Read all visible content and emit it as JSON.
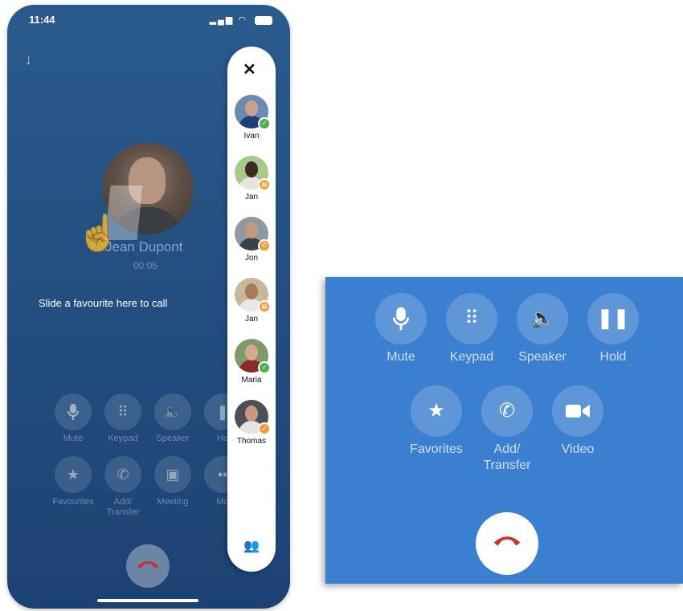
{
  "phone": {
    "status_time": "11:44",
    "caller_name": "Jean Dupont",
    "call_timer": "00:05",
    "slide_hint": "Slide a favourite here to call",
    "buttons": [
      {
        "label": "Mute",
        "icon": "microphone-icon"
      },
      {
        "label": "Keypad",
        "icon": "keypad-icon"
      },
      {
        "label": "Speaker",
        "icon": "speaker-icon"
      },
      {
        "label": "Ho",
        "icon": "pause-icon"
      },
      {
        "label": "Favourites",
        "icon": "star-icon"
      },
      {
        "label": "Add/\nTransfer",
        "icon": "add-call-icon"
      },
      {
        "label": "Meeting",
        "icon": "meeting-icon"
      },
      {
        "label": "Mo",
        "icon": "more-icon"
      }
    ]
  },
  "favourites": [
    {
      "name": "Ivan",
      "status": "available",
      "status_color": "#4caf50"
    },
    {
      "name": "Jan",
      "status": "busy",
      "status_color": "#f39a3a"
    },
    {
      "name": "Jon",
      "status": "on-call",
      "status_color": "#f39a3a"
    },
    {
      "name": "Jan",
      "status": "busy",
      "status_color": "#f39a3a"
    },
    {
      "name": "Maria",
      "status": "available",
      "status_color": "#4caf50"
    },
    {
      "name": "Thomas",
      "status": "away",
      "status_color": "#f39a3a"
    }
  ],
  "zoom": {
    "buttons": [
      {
        "label": "Mute",
        "icon": "microphone-icon"
      },
      {
        "label": "Keypad",
        "icon": "keypad-icon"
      },
      {
        "label": "Speaker",
        "icon": "speaker-icon"
      },
      {
        "label": "Hold",
        "icon": "pause-icon"
      },
      {
        "label": "Favorites",
        "icon": "star-icon"
      },
      {
        "label": "Add/\nTransfer",
        "icon": "add-call-icon"
      },
      {
        "label": "Video",
        "icon": "video-icon"
      }
    ]
  },
  "colors": {
    "phone_bg": "#244f80",
    "zoom_bg": "#3b7fd0",
    "hangup_red": "#d0312d",
    "accent_blue": "#2f6bc9"
  }
}
